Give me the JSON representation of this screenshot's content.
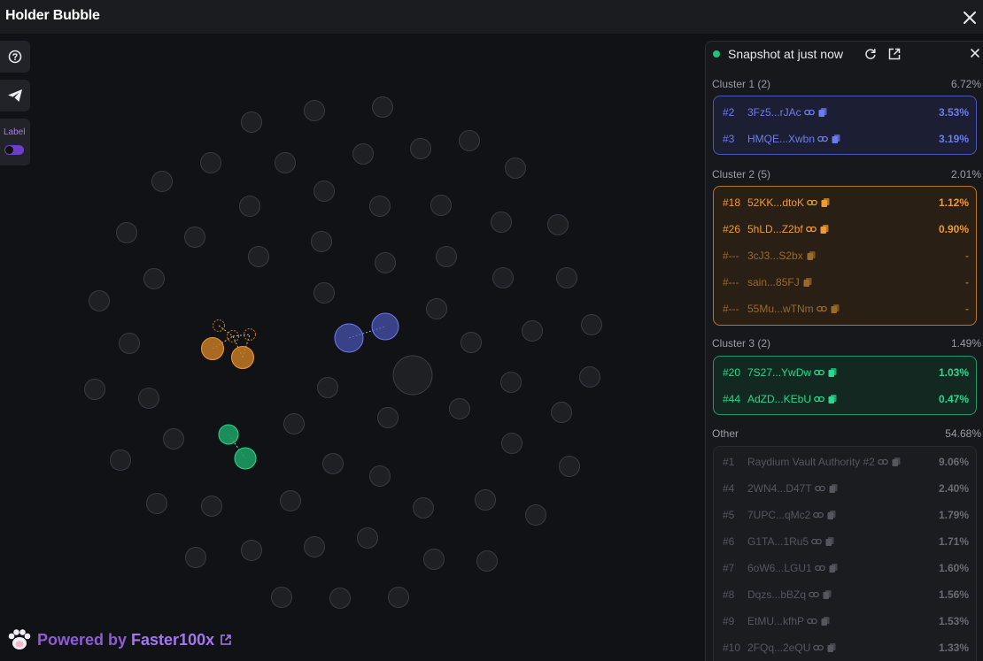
{
  "app": {
    "title": "Holder Bubble"
  },
  "toolbar": {
    "help_icon": "question-circle-icon",
    "telegram_icon": "paper-plane-icon",
    "label_toggle": "Label"
  },
  "footer": {
    "powered_prefix": "Powered by",
    "brand": "Faster100x"
  },
  "panel": {
    "snapshot_text": "Snapshot at just now",
    "clusters": [
      {
        "name": "Cluster 1 (2)",
        "percent": "6.72%",
        "accent": "#6c7cf0",
        "rows": [
          {
            "rank": "#2",
            "address": "3Fz5...rJAc",
            "percent": "3.53%"
          },
          {
            "rank": "#3",
            "address": "HMQE...Xwbn",
            "percent": "3.19%"
          }
        ]
      },
      {
        "name": "Cluster 2 (5)",
        "percent": "2.01%",
        "accent": "#f09a32",
        "rows": [
          {
            "rank": "#18",
            "address": "52KK...dtoK",
            "percent": "1.12%"
          },
          {
            "rank": "#26",
            "address": "5hLD...Z2bf",
            "percent": "0.90%"
          },
          {
            "rank": "#---",
            "address": "3cJ3...S2bx",
            "percent": "-"
          },
          {
            "rank": "#---",
            "address": "sain...85FJ",
            "percent": "-"
          },
          {
            "rank": "#---",
            "address": "55Mu...wTNm",
            "percent": "-"
          }
        ]
      },
      {
        "name": "Cluster 3 (2)",
        "percent": "1.49%",
        "accent": "#27d98c",
        "rows": [
          {
            "rank": "#20",
            "address": "7S27...YwDw",
            "percent": "1.03%"
          },
          {
            "rank": "#44",
            "address": "AdZD...KEbU",
            "percent": "0.47%"
          }
        ]
      }
    ],
    "other": {
      "name": "Other",
      "percent": "54.68%",
      "rows": [
        {
          "rank": "#1",
          "address": "Raydium Vault Authority #2",
          "percent": "9.06%"
        },
        {
          "rank": "#4",
          "address": "2WN4...D47T",
          "percent": "2.40%"
        },
        {
          "rank": "#5",
          "address": "7UPC...qMc2",
          "percent": "1.79%"
        },
        {
          "rank": "#6",
          "address": "G1TA...1Ru5",
          "percent": "1.71%"
        },
        {
          "rank": "#7",
          "address": "6oW6...LGU1",
          "percent": "1.60%"
        },
        {
          "rank": "#8",
          "address": "Dqzs...bBZq",
          "percent": "1.56%"
        },
        {
          "rank": "#9",
          "address": "EtMU...kfhP",
          "percent": "1.53%"
        },
        {
          "rank": "#10",
          "address": "2FQq...2eQU",
          "percent": "1.33%"
        }
      ]
    }
  },
  "colors": {
    "cluster1": "#4a55b8",
    "cluster2": "#c27a22",
    "cluster3": "#1e9a63",
    "bubble_neutral": "#26272b"
  }
}
